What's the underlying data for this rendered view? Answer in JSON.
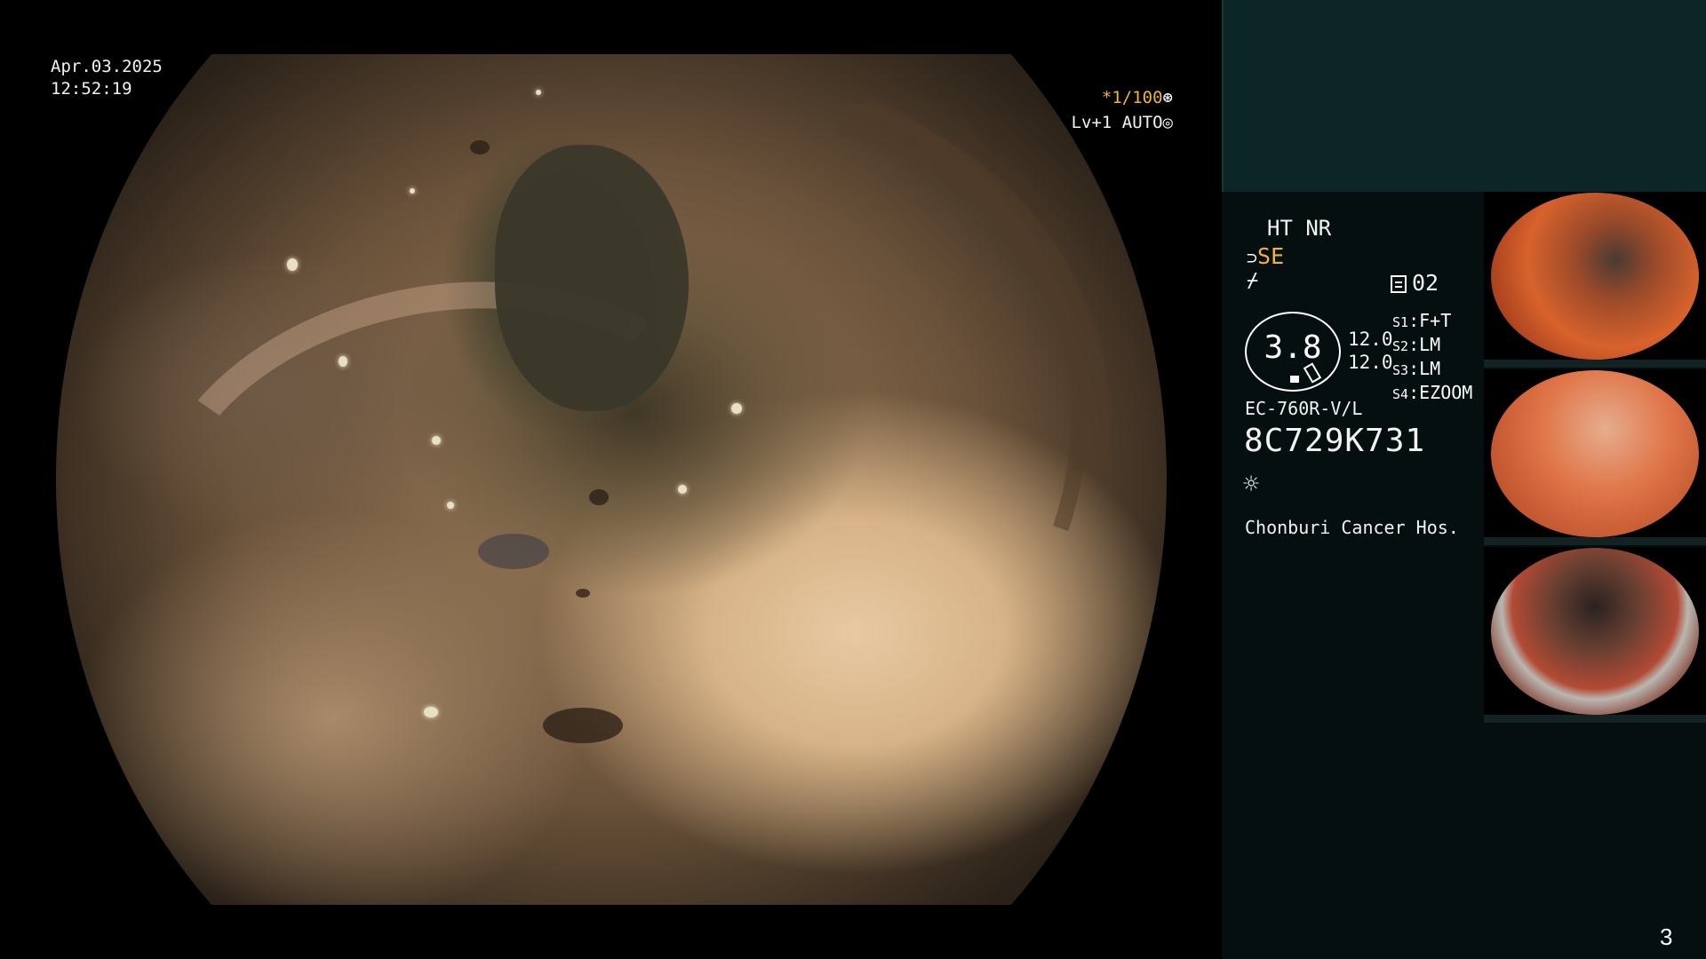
{
  "main": {
    "date": "Apr.03.2025",
    "time": "12:52:19",
    "shutter": "*1/100",
    "level": "Lv+1 AUTO"
  },
  "panel": {
    "ht_nr": "HT NR",
    "se": "SE",
    "page_indicator": "02",
    "zoom": "3.8",
    "value1": "12.0",
    "value2": "12.0",
    "slots": [
      {
        "key": "S1",
        "value": "F+T"
      },
      {
        "key": "S2",
        "value": "LM"
      },
      {
        "key": "S3",
        "value": "LM"
      },
      {
        "key": "S4",
        "value": "EZOOM"
      }
    ],
    "model": "EC-760R-V/L",
    "serial": "8C729K731",
    "hospital": "Chonburi Cancer Hos."
  },
  "page_number": "3"
}
